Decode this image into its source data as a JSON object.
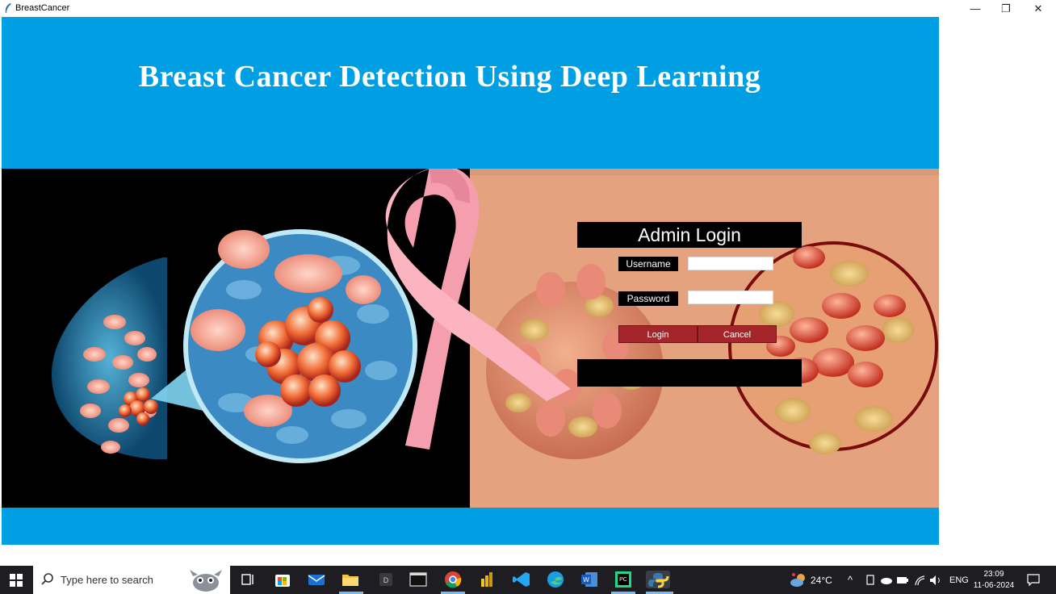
{
  "window": {
    "title": "BreastCancer",
    "minimize_glyph": "—",
    "restore_glyph": "❐",
    "close_glyph": "✕"
  },
  "app": {
    "title": "Breast Cancer Detection Using Deep Learning"
  },
  "login": {
    "title": "Admin Login",
    "username_label": "Username",
    "password_label": "Password",
    "username_value": "",
    "password_value": "",
    "login_button": "Login",
    "cancel_button": "Cancel",
    "status_message": ""
  },
  "taskbar": {
    "search_placeholder": "Type here to search",
    "weather": "24°C",
    "language": "ENG",
    "time": "23:09",
    "date": "11-06-2024",
    "apps": [
      "task-view",
      "microsoft-store",
      "mail",
      "file-explorer",
      "d-app",
      "terminal",
      "chrome",
      "power-bi",
      "vs-code",
      "edge",
      "word",
      "pycharm",
      "python"
    ]
  },
  "colors": {
    "header_blue": "#009fe3",
    "button_red": "#a4252a",
    "panel_black": "#000000",
    "taskbar_dark": "#1d1d22"
  }
}
